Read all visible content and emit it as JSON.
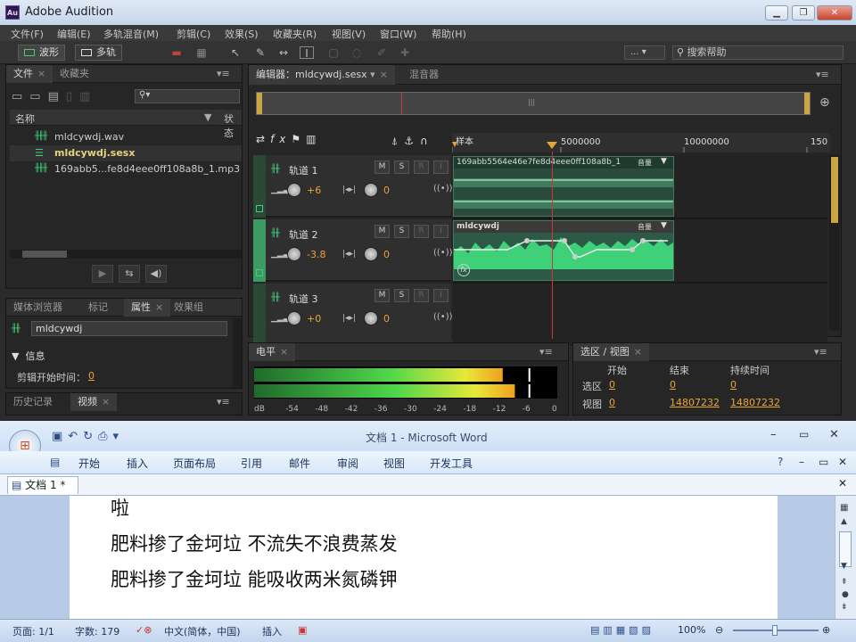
{
  "audition": {
    "title": "Adobe Audition",
    "logo": "Au",
    "menu": [
      "文件(F)",
      "编辑(E)",
      "多轨混音(M)",
      "剪辑(C)",
      "效果(S)",
      "收藏夹(R)",
      "视图(V)",
      "窗口(W)",
      "帮助(H)"
    ],
    "toolbar": {
      "waveform_label": "波形",
      "multitrack_label": "多轨",
      "workspace_value": "...",
      "search_placeholder": "搜索帮助"
    },
    "files_panel": {
      "tabs": [
        "文件",
        "收藏夹"
      ],
      "col_name": "名称",
      "col_status": "状态",
      "items": [
        {
          "name": "mldcywdj.wav",
          "icon": "waveform-icon",
          "active": false
        },
        {
          "name": "mldcywdj.sesx",
          "icon": "session-icon",
          "active": true
        },
        {
          "name": "169abb5...fe8d4eee0ff108a8b_1.mp3",
          "icon": "waveform-icon",
          "active": false
        }
      ]
    },
    "props_panel": {
      "tabs": [
        "媒体浏览器",
        "标记",
        "属性",
        "效果组"
      ],
      "file": "mldcywdj",
      "section": "信息",
      "start_label": "剪辑开始时间：",
      "start_value": "0"
    },
    "bottom_tabs": [
      "历史记录",
      "视频"
    ],
    "editor": {
      "tab": "编辑器：mldcywdj.sesx",
      "mixer_tab": "混音器",
      "ruler_unit": "样本",
      "ruler_ticks": [
        "5000000",
        "10000000",
        "150"
      ],
      "tracks": [
        {
          "name": "轨道 1",
          "volume": "+6",
          "pan": "0",
          "clip": "169abb5564e46e7fe8d4eee0ff108a8b_1",
          "clip_tag": "音量"
        },
        {
          "name": "轨道 2",
          "volume": "-3.8",
          "pan": "0",
          "clip": "mldcywdj",
          "clip_tag": "音量"
        },
        {
          "name": "轨道 3",
          "volume": "+0",
          "pan": "0"
        }
      ],
      "btn_m": "M",
      "btn_s": "S",
      "btn_r": "R",
      "btn_i": "I"
    },
    "levels": {
      "tab": "电平",
      "scale": [
        "dB",
        "-54",
        "-48",
        "-42",
        "-36",
        "-30",
        "-24",
        "-18",
        "-12",
        "-6",
        "0"
      ],
      "level_l": 0.82,
      "level_r": 0.86
    },
    "selection": {
      "tab": "选区 / 视图",
      "h_start": "开始",
      "h_end": "结束",
      "h_dur": "持续时间",
      "row_sel": "选区",
      "sel_start": "0",
      "sel_end": "0",
      "sel_dur": "0",
      "row_view": "视图",
      "view_start": "0",
      "view_end": "14807232",
      "view_dur": "14807232"
    }
  },
  "word": {
    "title": "文档 1 - Microsoft Word",
    "ribbon": [
      "开始",
      "插入",
      "页面布局",
      "引用",
      "邮件",
      "审阅",
      "视图",
      "开发工具"
    ],
    "doc_tab": "文档 1 *",
    "lines": [
      "啦",
      "肥料掺了金坷垃  不流失不浪费蒸发",
      "肥料掺了金坷垃  能吸收两米氮磷钾"
    ],
    "status": {
      "page": "页面: 1/1",
      "words": "字数: 179",
      "lang": "中文(简体，中国)",
      "mode": "插入",
      "zoom": "100%"
    }
  },
  "colors": {
    "accent_green": "#3fd07a",
    "time_marker": "#e8a533",
    "playhead": "#c83a3a"
  }
}
